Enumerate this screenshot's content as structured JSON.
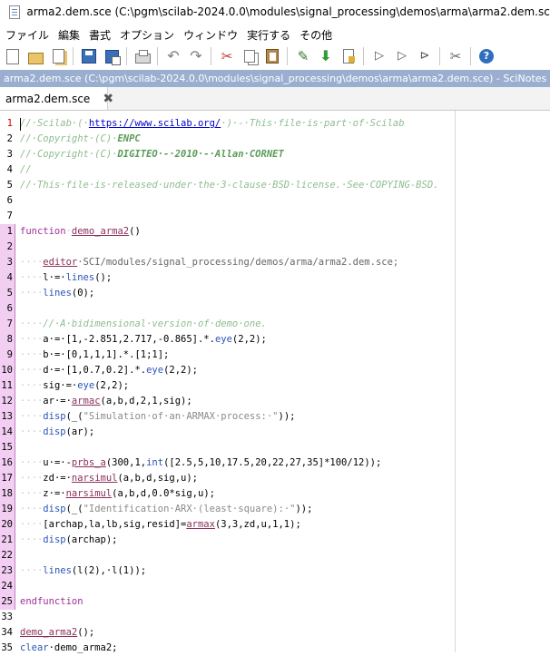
{
  "window": {
    "title": "arma2.dem.sce (C:\\pgm\\scilab-2024.0.0\\modules\\signal_processing\\demos\\arma\\arma2.dem.sce) - SciNotes"
  },
  "menu": {
    "items": [
      "ファイル",
      "編集",
      "書式",
      "オプション",
      "ウィンドウ",
      "実行する",
      "その他"
    ]
  },
  "toolbar": {
    "icons": [
      "new-file-icon",
      "open-file-icon",
      "open-recent-icon",
      "save-icon",
      "save-as-icon",
      "print-icon",
      "undo-icon",
      "redo-icon",
      "cut-icon",
      "copy-icon",
      "paste-icon",
      "execute-file-icon",
      "execute-selection-icon",
      "execute-to-cursor-icon",
      "run-icon",
      "run-step-icon",
      "run-until-icon",
      "tools-icon",
      "help-icon"
    ]
  },
  "infobar": {
    "text": "arma2.dem.sce (C:\\pgm\\scilab-2024.0.0\\modules\\signal_processing\\demos\\arma\\arma2.dem.sce) - SciNotes"
  },
  "tab": {
    "label": "arma2.dem.sce",
    "close_symbol": "✖"
  },
  "editor": {
    "line_numbers": [
      "1",
      "2",
      "3",
      "4",
      "5",
      "6",
      "7",
      "1",
      "2",
      "3",
      "4",
      "5",
      "6",
      "7",
      "8",
      "9",
      "10",
      "11",
      "12",
      "13",
      "14",
      "15",
      "16",
      "17",
      "18",
      "19",
      "20",
      "21",
      "22",
      "23",
      "24",
      "25",
      "33",
      "34",
      "35"
    ],
    "code": {
      "l1_pre": "//·Scilab·(·",
      "l1_url": "https://www.scilab.org/",
      "l1_post": "·)·-·This·file·is·part·of·Scilab",
      "l2_a": "//·Copyright·(C)·",
      "l2_b": "ENPC",
      "l3_a": "//·Copyright·(C)·",
      "l3_b": "DIGITEO·-·2010·-·Allan·CORNET",
      "l4": "//",
      "l5": "//·This·file·is·released·under·the·3-clause·BSD·license.·See·COPYING-BSD.",
      "f_kw": "function",
      "f_name": "demo_arma2",
      "f_parens": "()",
      "ind": "····",
      "l3_fn": "editor",
      "l3_path": "·SCI/modules/signal_processing/demos/arma/arma2.dem.sce;",
      "l4_a": "l·=·",
      "l4_fn": "lines",
      "l4_b": "();",
      "l5_fn": "lines",
      "l5_b": "(0);",
      "l7_cm": "//·A·bidimensional·version·of·demo·one.",
      "l8_a": "a·=·[1,-2.851,2.717,-0.865].*.",
      "l8_fn": "eye",
      "l8_b": "(2,2);",
      "l9": "b·=·[0,1,1,1].*.[1;1];",
      "l10_a": "d·=·[1,0.7,0.2].*.",
      "l10_fn": "eye",
      "l10_b": "(2,2);",
      "l11_a": "sig·=·",
      "l11_fn": "eye",
      "l11_b": "(2,2);",
      "l12_a": "ar·=·",
      "l12_fn": "armac",
      "l12_b": "(a,b,d,2,1,sig);",
      "l13_fn": "disp",
      "l13_a": "(_(",
      "l13_str": "\"Simulation·of·an·ARMAX·process:·\"",
      "l13_b": "));",
      "l14_fn": "disp",
      "l14_b": "(ar);",
      "l16_a": "u·=·-",
      "l16_fn": "prbs_a",
      "l16_b": "(300,1,",
      "l16_fn2": "int",
      "l16_c": "([2.5,5,10,17.5,20,22,27,35]*100/12));",
      "l17_a": "zd·=·",
      "l17_fn": "narsimul",
      "l17_b": "(a,b,d,sig,u);",
      "l18_a": "z·=·",
      "l18_fn": "narsimul",
      "l18_b": "(a,b,d,0.0*sig,u);",
      "l19_fn": "disp",
      "l19_a": "(_(",
      "l19_str": "\"Identification·ARX·(least·square):·\"",
      "l19_b": "));",
      "l20_a": "[archap,la,lb,sig,resid]=",
      "l20_fn": "armax",
      "l20_b": "(3,3,zd,u,1,1);",
      "l21_fn": "disp",
      "l21_b": "(archap);",
      "l23_fn": "lines",
      "l23_b": "(l(2),·l(1));",
      "end_kw": "endfunction",
      "l34_fn": "demo_arma2",
      "l34_b": "();",
      "l35_kw": "clear",
      "l35_b": "·demo_arma2;"
    }
  }
}
